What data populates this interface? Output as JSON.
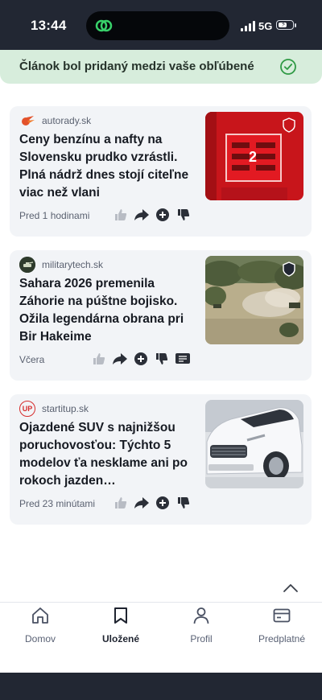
{
  "status_bar": {
    "time": "13:44",
    "network": "5G",
    "battery_level": 0.65
  },
  "toast": {
    "message": "Článok bol pridaný medzi vaše obľúbené",
    "icon": "check-circle-icon",
    "color": "#d7eddc"
  },
  "articles": [
    {
      "source": "autorady.sk",
      "logo": "autorady-logo",
      "title": "Ceny benzínu a nafty na Slovensku prudko vzrástli. Plná nádrž dnes stojí citeľne viac než vlani",
      "time": "Pred 1 hodinami",
      "image": "fuel-pump-price-display",
      "image_badge": "shield-badge-icon",
      "image_number": "2",
      "actions": [
        "like-icon",
        "share-icon",
        "add-icon",
        "dislike-icon"
      ]
    },
    {
      "source": "militarytech.sk",
      "logo": "militarytech-logo",
      "title": "Sahara 2026 premenila Záhorie na púštne bojisko. Ožila legendárna obrana pri Bir Hakeime",
      "time": "Včera",
      "image": "military-vehicles-dust",
      "image_badge": "shield-badge-icon",
      "actions": [
        "like-icon",
        "share-icon",
        "add-icon",
        "dislike-icon",
        "comments-icon"
      ]
    },
    {
      "source": "startitup.sk",
      "logo": "startitup-logo",
      "logo_text": "UP",
      "title": "Ojazdené SUV s najnižšou poruchovosťou: Týchto 5 modelov ťa nesklame ani po rokoch jazden…",
      "time": "Pred 23 minútami",
      "image": "white-suv-car",
      "actions": [
        "like-icon",
        "share-icon",
        "add-icon",
        "dislike-icon"
      ]
    }
  ],
  "nav": [
    {
      "label": "Domov",
      "icon": "home-icon",
      "active": false
    },
    {
      "label": "Uložené",
      "icon": "bookmark-icon",
      "active": true
    },
    {
      "label": "Profil",
      "icon": "profile-icon",
      "active": false
    },
    {
      "label": "Predplatné",
      "icon": "card-icon",
      "active": false
    }
  ]
}
